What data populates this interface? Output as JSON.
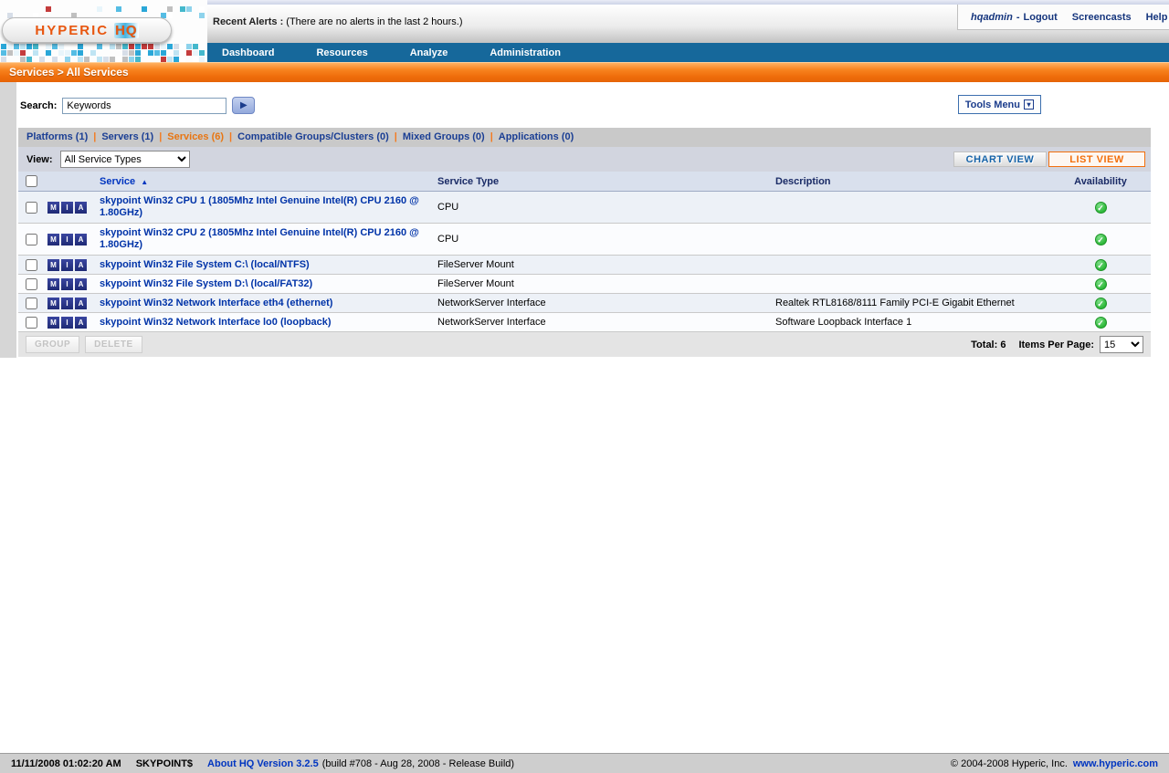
{
  "colors": {
    "nav_bar_blue": "#16689b",
    "breadcrumb_orange": "#f26f0d",
    "tab_link_blue": "#1a3e94",
    "active_tab_orange": "#e87511",
    "service_link_blue": "#0033a8",
    "table_header_bg": "#d9e0ed",
    "row_alt_bg": "#edf1f7",
    "available_green": "#2eb83a",
    "mia_badge_navy": "#1f2a75",
    "logo_orange": "#e8560f",
    "mosaic_palette": [
      "#ffffff",
      "#e8f5fb",
      "#bfe4f3",
      "#8ed3ec",
      "#55bde4",
      "#2aa7d8",
      "#d7dee8",
      "#c43c3c",
      "#44b8cc",
      "#c0c0c0"
    ]
  },
  "icons": {
    "dropdown_arrow": "▾",
    "submit_arrow": "▶",
    "sort_asc": "▲",
    "check": "✓"
  },
  "header": {
    "logo_text": "HYPERIC",
    "logo_h": "H",
    "logo_q": "Q",
    "recent_alerts_label": "Recent Alerts :",
    "recent_alerts_value": "(There are no alerts in the last 2 hours.)",
    "username": "hqadmin",
    "user_sep": "-",
    "logout_label": "Logout",
    "screencasts_label": "Screencasts",
    "help_label": "Help"
  },
  "nav": {
    "items": [
      "Dashboard",
      "Resources",
      "Analyze",
      "Administration"
    ]
  },
  "breadcrumb": "Services > All Services",
  "search": {
    "label": "Search:",
    "value": "Keywords"
  },
  "tools_menu_label": "Tools Menu",
  "tabs": [
    {
      "label": "Platforms (1)",
      "active": false
    },
    {
      "label": "Servers (1)",
      "active": false
    },
    {
      "label": "Services (6)",
      "active": true
    },
    {
      "label": "Compatible Groups/Clusters (0)",
      "active": false
    },
    {
      "label": "Mixed Groups (0)",
      "active": false
    },
    {
      "label": "Applications (0)",
      "active": false
    }
  ],
  "view": {
    "label": "View:",
    "selected": "All Service Types"
  },
  "view_toggle": {
    "chart_label": "CHART VIEW",
    "list_label": "LIST VIEW",
    "active": "list"
  },
  "table": {
    "columns": {
      "service": "Service",
      "type": "Service Type",
      "description": "Description",
      "availability": "Availability"
    },
    "sorted_column": "Service",
    "mia_labels": [
      "M",
      "I",
      "A"
    ],
    "rows": [
      {
        "service": "skypoint Win32 CPU 1 (1805Mhz Intel Genuine Intel(R) CPU 2160 @ 1.80GHz)",
        "type": "CPU",
        "description": "",
        "availability": "ok"
      },
      {
        "service": "skypoint Win32 CPU 2 (1805Mhz Intel Genuine Intel(R) CPU 2160 @ 1.80GHz)",
        "type": "CPU",
        "description": "",
        "availability": "ok"
      },
      {
        "service": "skypoint Win32 File System C:\\ (local/NTFS)",
        "type": "FileServer Mount",
        "description": "",
        "availability": "ok"
      },
      {
        "service": "skypoint Win32 File System D:\\ (local/FAT32)",
        "type": "FileServer Mount",
        "description": "",
        "availability": "ok"
      },
      {
        "service": "skypoint Win32 Network Interface eth4 (ethernet)",
        "type": "NetworkServer Interface",
        "description": "Realtek RTL8168/8111 Family PCI-E Gigabit Ethernet",
        "availability": "ok"
      },
      {
        "service": "skypoint Win32 Network Interface lo0 (loopback)",
        "type": "NetworkServer Interface",
        "description": "Software Loopback Interface 1",
        "availability": "ok"
      }
    ]
  },
  "table_footer": {
    "group_label": "GROUP",
    "delete_label": "DELETE",
    "total_label": "Total: 6",
    "items_per_page_label": "Items Per Page:",
    "items_per_page_value": "15"
  },
  "footer": {
    "timestamp": "11/11/2008 01:02:20 AM",
    "host": "SKYPOINT$",
    "about_link": "About HQ Version 3.2.5",
    "build_info": "(build #708 - Aug 28, 2008 - Release Build)",
    "copyright": "© 2004-2008 Hyperic, Inc.",
    "site_link": "www.hyperic.com"
  }
}
